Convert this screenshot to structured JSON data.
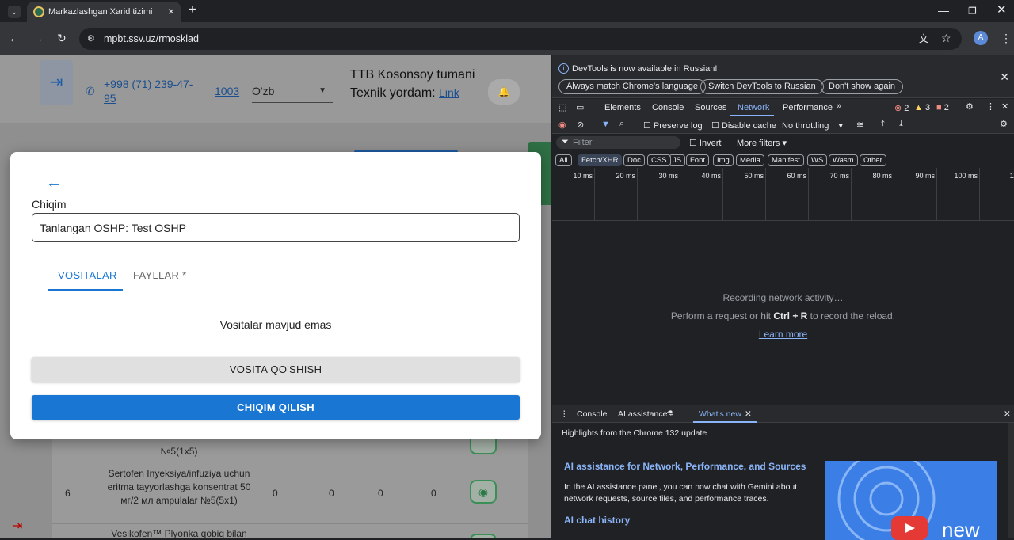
{
  "browser": {
    "tab_title": "Markazlashgan Xarid tizimi",
    "new_tab": "+",
    "url": "mpbt.ssv.uz/rmosklad",
    "avatar_letter": "A"
  },
  "page": {
    "phone": "+998 (71) 239-47-95",
    "code": "1003",
    "language": "O'zb",
    "region": "TTB Kosonsoy tumani",
    "support_label": "Texnik yordam:",
    "support_link": "Link",
    "rows": [
      {
        "name": "№5(1x5)",
        "index": "",
        "values": [
          "",
          "",
          "",
          ""
        ]
      },
      {
        "index": "6",
        "name": "Sertofen Inyeksiya/infuziya uchun eritma tayyorlashga konsentrat 50 мг/2 мл ampulalar №5(5x1)",
        "values": [
          "0",
          "0",
          "0",
          "0"
        ]
      },
      {
        "index": "",
        "name": "Vesikofen™ Plyonka qobiq bilan",
        "values": [
          "",
          "",
          "",
          ""
        ]
      }
    ]
  },
  "modal": {
    "label": "Chiqim",
    "field_value": "Tanlangan OSHP: Test OSHP",
    "tabs": [
      {
        "label": "VOSITALAR",
        "active": true
      },
      {
        "label": "FAYLLAR *",
        "active": false
      }
    ],
    "empty_text": "Vositalar mavjud emas",
    "add_button": "VOSITA QO'SHISH",
    "submit_button": "CHIQIM QILISH"
  },
  "devtools": {
    "info_message": "DevTools is now available in Russian!",
    "info_buttons": [
      "Always match Chrome's language",
      "Switch DevTools to Russian",
      "Don't show again"
    ],
    "panels": [
      "Elements",
      "Console",
      "Sources",
      "Network",
      "Performance"
    ],
    "active_panel": "Network",
    "errors": "2",
    "warnings": "3",
    "issues": "2",
    "preserve_log": "Preserve log",
    "disable_cache": "Disable cache",
    "throttling": "No throttling",
    "filter_placeholder": "Filter",
    "invert": "Invert",
    "more_filters": "More filters",
    "type_filters": [
      "All",
      "Fetch/XHR",
      "Doc",
      "CSS",
      "JS",
      "Font",
      "Img",
      "Media",
      "Manifest",
      "WS",
      "Wasm",
      "Other"
    ],
    "active_type": "Fetch/XHR",
    "timeline_ticks": [
      "10 ms",
      "20 ms",
      "30 ms",
      "40 ms",
      "50 ms",
      "60 ms",
      "70 ms",
      "80 ms",
      "90 ms",
      "100 ms",
      "110"
    ],
    "recording": "Recording network activity…",
    "perform_prefix": "Perform a request or hit ",
    "perform_keys": "Ctrl + R",
    "perform_suffix": " to record the reload.",
    "learn_more": "Learn more",
    "drawer_tabs": [
      "Console",
      "AI assistance",
      "What's new"
    ],
    "drawer_active": "What's new",
    "highlights": "Highlights from the Chrome 132 update",
    "article_title": "AI assistance for Network, Performance, and Sources",
    "article_text": "In the AI assistance panel, you can now chat with Gemini about network requests, source files, and performance traces.",
    "article2_title": "AI chat history",
    "promo_text": "new"
  }
}
